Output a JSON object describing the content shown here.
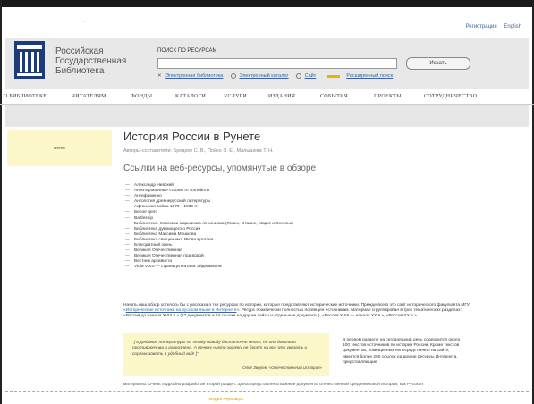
{
  "top_links": [
    "Регистрация",
    "English"
  ],
  "header": {
    "library_name": [
      "Российская",
      "Государственная",
      "Библиотека"
    ],
    "search_title": "ПОИСК ПО РЕСУРСАМ",
    "search_value": "",
    "search_button": "Искать",
    "options": [
      "Электронная библиотека",
      "Электронный каталог",
      "Сайт"
    ],
    "extended_search": "Расширенный поиск"
  },
  "nav": [
    "О БИБЛИОТЕКЕ",
    "ЧИТАТЕЛЯМ",
    "ФОНДЫ",
    "КАТАЛОГИ",
    "УСЛУГИ",
    "ИЗДАНИЯ",
    "СОБЫТИЯ",
    "ПРОЕКТЫ",
    "СОТРУДНИЧЕСТВО"
  ],
  "sidebox_label": "меню",
  "article": {
    "title": "История России в Рунете",
    "authors": "Авторы-составители: Бредихе С. В., Пойко Э. Е., Малышева Т. Н.",
    "subtitle": "Ссылки на веб-ресурсы, упомянутые в обзоре",
    "list": [
      "Александр Невский",
      "Аннотированные ссылки от Вэлойоты",
      "Антифоменко",
      "Антология древнерусской литературы",
      "Афганская война 1979—1989 гг.",
      "Белое дело",
      "Battleship",
      "Библиотека. Классики марксизма-ленинизма (Ленин, Сталин, Маркс и Энгельс)",
      "Библиотека думающего о России",
      "Библиотека Максима Мошкова",
      "Библиотека священника Якова Кротова",
      "Благодатный огонь",
      "Великая Отечественная",
      "Великая Отечественная под водой",
      "Вестник архивиста",
      "Viola Voco — страница Натана Эйдельмана"
    ],
    "para_start": "Начать наш обзор хотелось бы с рассказа о тех ресурсах по истории, которые представляют исторические источники. Прежде всего это сайт исторического факультета МГУ «",
    "para_link": "Исторические источники на русском языке в Интернете",
    "para_end": "». Ресурс практически полностью посвящен источникам. Материал сгруппирован в трех тематических разделах: «Россия до начала XVIII в.» (67 документов и 64 ссылки на другие сайты и отдельные документы), «Россия XVIII — начала XX в.», «Россия XX в.».",
    "quote": "\"[ Ерундовой литературы по этому поводу достаточно много, но она довольно противоречива и разрознена. А почему никто задачку не берет на все это увязать и сорганизовать в удобный вид! ]\"",
    "quote_author": "Олег Зверев, «Отечественная история»",
    "right_para": "В первом разделе на сегодняшний день содержится около 100 текстов источников по истории России. Кроме текстов документов, помещенных непосредственно на сайте, имеется более 250 ссылок на другие ресурсы Интернета, представляющие",
    "bottom_text": "материалы. Очень подробно разработан второй раздел. Здесь представлены важные документы отечественной средневековой истории, как Русская"
  },
  "footer_link": "раздел страницы"
}
